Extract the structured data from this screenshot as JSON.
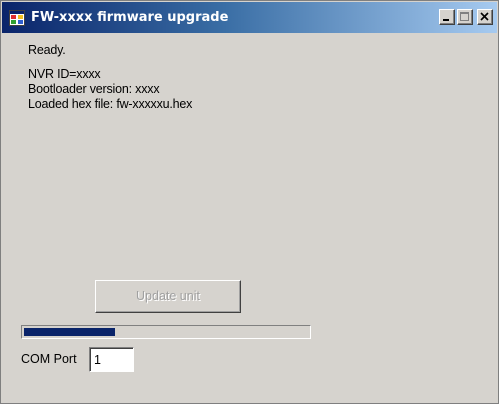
{
  "window": {
    "title": "FW-xxxx firmware upgrade",
    "icons": {
      "app": "app-window-icon",
      "minimize": "minimize-icon",
      "maximize": "maximize-icon",
      "close": "close-icon"
    }
  },
  "status": {
    "ready": "Ready.",
    "nvr_id": "NVR ID=xxxx",
    "bootloader_version": "Bootloader version: xxxx",
    "loaded_file": "Loaded hex file: fw-xxxxxu.hex"
  },
  "update_button": {
    "label": "Update unit",
    "enabled": false
  },
  "progress": {
    "fraction": 0.32,
    "color": "#0a246a"
  },
  "com_port": {
    "label": "COM Port",
    "value": "1"
  },
  "colors": {
    "window_background": "#d6d3ce",
    "titlebar_start": "#0a246a",
    "titlebar_end": "#a6caf0",
    "disabled_text": "#a0a0a0"
  }
}
